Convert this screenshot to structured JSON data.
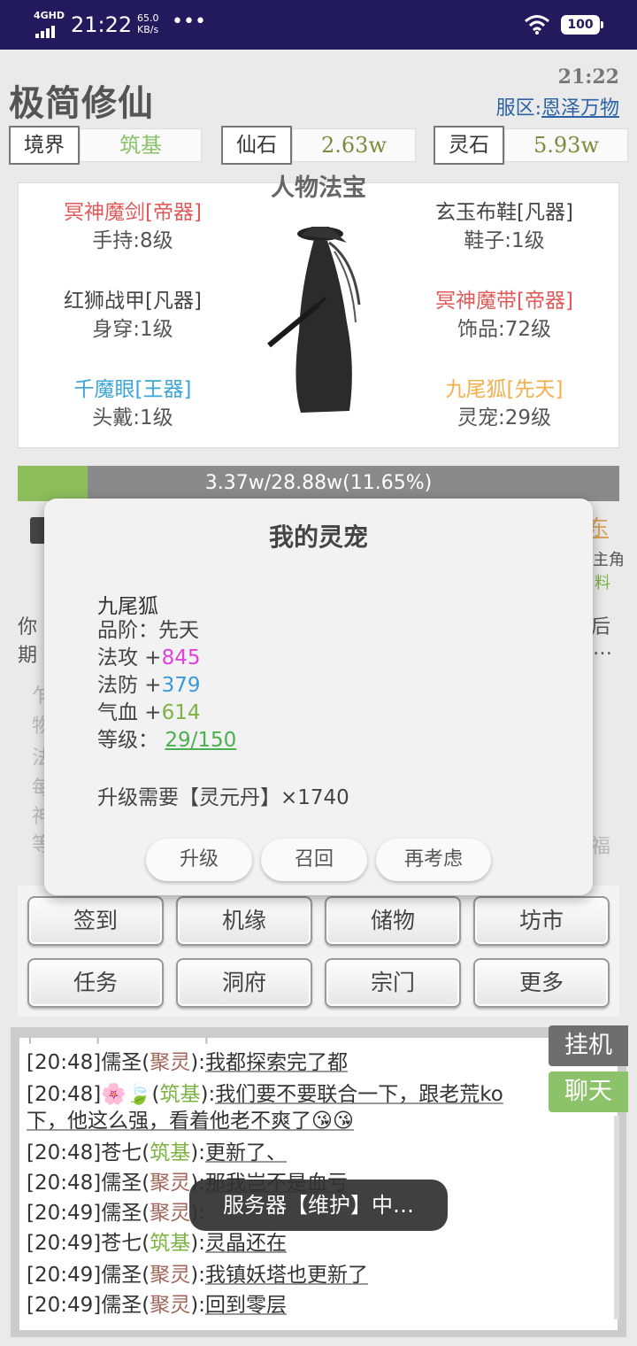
{
  "status_bar": {
    "network": "4GHD",
    "time": "21:22",
    "speed": "65.0",
    "speed_unit": "KB/s",
    "battery": "100"
  },
  "app": {
    "title": "极简修仙",
    "clock": "21:22",
    "server_label": "服区:",
    "server_name": "恩泽万物"
  },
  "stats": [
    {
      "label": "境界",
      "value": "筑基",
      "color": "#8cc269"
    },
    {
      "label": "仙石",
      "value": "2.63w",
      "color": "#7a8d3c"
    },
    {
      "label": "灵石",
      "value": "5.93w",
      "color": "#7a8d3c"
    }
  ],
  "equipment": {
    "title": "人物法宝",
    "items": [
      {
        "name": "冥神魔剑[帝器]",
        "slot": "手持:8级",
        "color": "#e05a5a"
      },
      {
        "name": "玄玉布鞋[凡器]",
        "slot": "鞋子:1级",
        "color": "#444444"
      },
      {
        "name": "红狮战甲[凡器]",
        "slot": "身穿:1级",
        "color": "#444444"
      },
      {
        "name": "冥神魔带[帝器]",
        "slot": "饰品:72级",
        "color": "#e05a5a"
      },
      {
        "name": "千魔眼[王器]",
        "slot": "头戴:1级",
        "color": "#3aa6d8"
      },
      {
        "name": "九尾狐[先天]",
        "slot": "灵宠:29级",
        "color": "#f2b04c"
      }
    ]
  },
  "progress": {
    "text": "3.37w/28.88w(11.65%)",
    "fraction": 0.1165
  },
  "background_text": {
    "left_line1": "你",
    "left_line2": "期",
    "right_line1": "后",
    "right_line2": "…",
    "tab_partial": "东",
    "right_small1": "主角",
    "right_small2": "料",
    "right_fu": "福",
    "list_partial": [
      "乍",
      "物",
      "法",
      "每",
      "神",
      "等"
    ]
  },
  "grid_buttons": [
    "签到",
    "机缘",
    "储物",
    "坊市",
    "任务",
    "洞府",
    "宗门",
    "更多"
  ],
  "chat": {
    "lines": [
      {
        "time": "[20:48]",
        "name": "儒圣",
        "rank": "聚灵",
        "rank_class": "rk-jl",
        "msg": "我都探索完了都"
      },
      {
        "time": "[20:48]",
        "name": "🌸🍃",
        "rank": "筑基",
        "rank_class": "rk-zj",
        "msg": "我们要不要联合一下，跟老荒ko"
      },
      {
        "time": "",
        "name": "",
        "rank": "",
        "rank_class": "",
        "msg": "下，他这么强，看着他老不爽了😘😘"
      },
      {
        "time": "[20:48]",
        "name": "苍七",
        "rank": "筑基",
        "rank_class": "rk-zj",
        "msg": "更新了、"
      },
      {
        "time": "[20:48]",
        "name": "儒圣",
        "rank": "聚灵",
        "rank_class": "rk-jl",
        "msg": "那我岂不是血亏"
      },
      {
        "time": "[20:49]",
        "name": "儒圣",
        "rank": "聚灵",
        "rank_class": "rk-jl",
        "msg": ""
      },
      {
        "time": "[20:49]",
        "name": "苍七",
        "rank": "筑基",
        "rank_class": "rk-zj",
        "msg": "灵晶还在"
      },
      {
        "time": "[20:49]",
        "name": "儒圣",
        "rank": "聚灵",
        "rank_class": "rk-jl",
        "msg": "我镇妖塔也更新了"
      },
      {
        "time": "[20:49]",
        "name": "儒圣",
        "rank": "聚灵",
        "rank_class": "rk-jl",
        "msg": "回到零层"
      }
    ],
    "tab_idle": "挂机",
    "tab_chat": "聊天",
    "toast": "服务器【维护】中…"
  },
  "modal": {
    "title": "我的灵宠",
    "pet_name": "九尾狐",
    "grade_label": "品阶：",
    "grade_value": "先天",
    "attack_label": "法攻 +",
    "attack_value": "845",
    "defense_label": "法防 +",
    "defense_value": "379",
    "hp_label": "气血 +",
    "hp_value": "614",
    "level_label": "等级：",
    "level_value": "29/150",
    "cost_text": "升级需要【灵元丹】×1740",
    "buttons": [
      "升级",
      "召回",
      "再考虑"
    ],
    "colors": {
      "attack": "#e040e0",
      "defense": "#3a9ad9",
      "hp": "#7cb342",
      "level": "#4caf50"
    }
  }
}
